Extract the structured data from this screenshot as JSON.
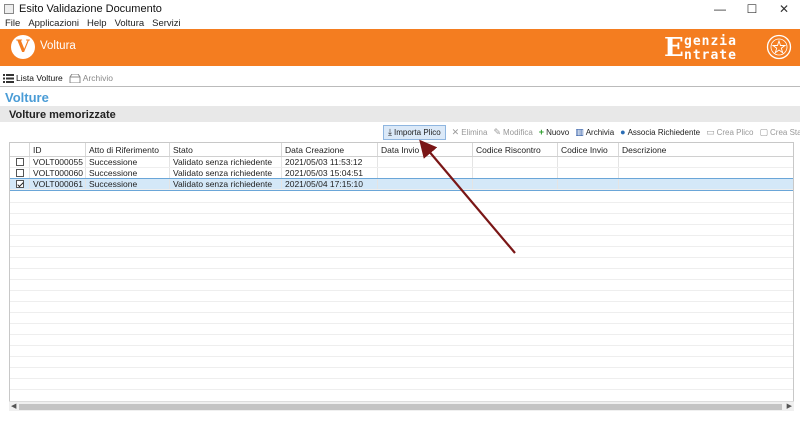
{
  "window": {
    "title": "Esito Validazione Documento",
    "controls": [
      "—",
      "☐",
      "✕"
    ]
  },
  "menu": [
    "File",
    "Applicazioni",
    "Help",
    "Voltura",
    "Servizi"
  ],
  "banner": {
    "logo_letter": "V",
    "label": "Voltura",
    "brand_big": "E",
    "brand_line1": "genzia",
    "brand_line2": "ntrate",
    "color": "#f47d20"
  },
  "tabs": [
    {
      "label": "Lista Volture",
      "icon": "list-icon"
    },
    {
      "label": "Archivio",
      "icon": "archive-icon"
    }
  ],
  "heading": "Volture",
  "section_title": "Volture memorizzate",
  "toolbar": {
    "importa": "Importa Plico",
    "elimina": "Elimina",
    "modifica": "Modifica",
    "nuovo": "Nuovo",
    "archivia": "Archivia",
    "associa": "Associa Richiedente",
    "crea_plico": "Crea Plico",
    "crea_stampa": "Crea Stampa"
  },
  "columns": [
    "ID",
    "Atto di Riferimento",
    "Stato",
    "Data Creazione",
    "Data Invio",
    "Codice Riscontro",
    "Codice Invio",
    "Descrizione"
  ],
  "rows": [
    {
      "checked": false,
      "id": "VOLT000055",
      "atto": "Successione",
      "stato": "Validato senza richiedente",
      "data": "2021/05/03 11:53:12"
    },
    {
      "checked": false,
      "id": "VOLT000060",
      "atto": "Successione",
      "stato": "Validato senza richiedente",
      "data": "2021/05/03 15:04:51"
    },
    {
      "checked": true,
      "id": "VOLT000061",
      "atto": "Successione",
      "stato": "Validato senza richiedente",
      "data": "2021/05/04 17:15:10"
    }
  ],
  "annotation_color": "#7a1616"
}
